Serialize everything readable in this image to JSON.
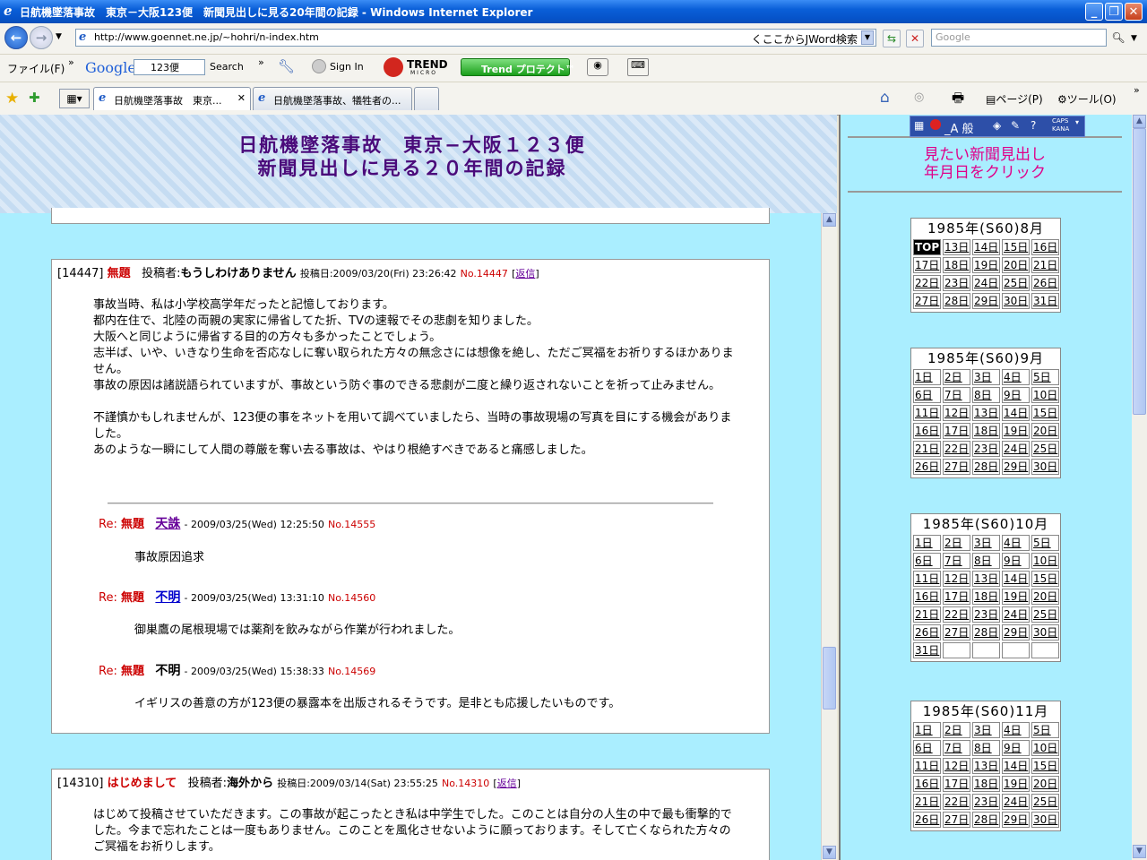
{
  "window": {
    "title": "日航機墜落事故　東京－大阪123便　新聞見出しに見る20年間の記録 - Windows Internet Explorer"
  },
  "address": {
    "url": "http://www.goennet.ne.jp/~hohri/n-index.htm",
    "jword": "くここからJWord検索",
    "search_placeholder": "Google"
  },
  "toolbar": {
    "file_menu": "ファイル(F)",
    "google_label": "Google",
    "google_field": "123便",
    "search_label": "Search",
    "signin_label": "Sign In",
    "trend_label": "TREND",
    "trend_sub": "MICRO",
    "trend_protect": "Trend プロテクト™"
  },
  "tabs": [
    {
      "label": "日航機墜落事故　東京..."
    },
    {
      "label": "日航機墜落事故、犠牲者の..."
    }
  ],
  "commandbar": {
    "page_label": "ページ(P)",
    "tools_label": "ツール(O)"
  },
  "banner": {
    "line1": "日航機墜落事故　東京−大阪１２３便",
    "line2": "新聞見出しに見る２０年間の記録"
  },
  "posts": [
    {
      "id": "[14447]",
      "title": "無題",
      "author_label": "投稿者:",
      "author": "もうしわけありません",
      "date": "投稿日:2009/03/20(Fri) 23:26:42",
      "no": "No.14447",
      "reply_link": "返信",
      "body": "事故当時、私は小学校高学年だったと記憶しております。\n都内在住で、北陸の両親の実家に帰省してた折、TVの速報でその悲劇を知りました。\n大阪へと同じように帰省する目的の方々も多かったことでしょう。\n志半ば、いや、いきなり生命を否応なしに奪い取られた方々の無念さには想像を絶し、ただご冥福をお祈りするほかありません。\n事故の原因は諸説語られていますが、事故という防ぐ事のできる悲劇が二度と繰り返されないことを祈って止みません。\n\n不謹慎かもしれませんが、123便の事をネットを用いて調べていましたら、当時の事故現場の写真を目にする機会がありました。\nあのような一瞬にして人間の尊厳を奪い去る事故は、やはり根絶すべきであると痛感しました。",
      "replies": [
        {
          "prefix": "Re: ",
          "title": "無題",
          "author": "天誅",
          "date": "- 2009/03/25(Wed) 12:25:50",
          "no": "No.14555",
          "body": "事故原因追求"
        },
        {
          "prefix": "Re: ",
          "title": "無題",
          "author": "不明",
          "date": "- 2009/03/25(Wed) 13:31:10",
          "no": "No.14560",
          "body": "御巣鷹の尾根現場では薬剤を飲みながら作業が行われました。"
        },
        {
          "prefix": "Re: ",
          "title": "無題",
          "author": "不明",
          "date": "- 2009/03/25(Wed) 15:38:33",
          "no": "No.14569",
          "body": "イギリスの善意の方が123便の暴露本を出版されるそうです。是非とも応援したいものです。"
        }
      ]
    },
    {
      "id": "[14310]",
      "title": "はじめまして",
      "author_label": "投稿者:",
      "author": "海外から",
      "date": "投稿日:2009/03/14(Sat) 23:55:25",
      "no": "No.14310",
      "reply_link": "返信",
      "body": "はじめて投稿させていただきます。この事故が起こったとき私は中学生でした。このことは自分の人生の中で最も衝撃的でした。今まで忘れたことは一度もありません。このことを風化させないように願っております。そして亡くなられた方々のご冥福をお祈りします。"
    }
  ],
  "right": {
    "ime": "_A 般",
    "caps": "CAPS",
    "kana": "KANA",
    "heading1": "見たい新聞見出し",
    "heading2": "年月日をクリック",
    "calendars": [
      {
        "title": "1985年(S60)8月",
        "days": [
          "TOP",
          "13日",
          "14日",
          "15日",
          "16日",
          "17日",
          "18日",
          "19日",
          "20日",
          "21日",
          "22日",
          "23日",
          "24日",
          "25日",
          "26日",
          "27日",
          "28日",
          "29日",
          "30日",
          "31日"
        ]
      },
      {
        "title": "1985年(S60)9月",
        "days": [
          "1日",
          "2日",
          "3日",
          "4日",
          "5日",
          "6日",
          "7日",
          "8日",
          "9日",
          "10日",
          "11日",
          "12日",
          "13日",
          "14日",
          "15日",
          "16日",
          "17日",
          "18日",
          "19日",
          "20日",
          "21日",
          "22日",
          "23日",
          "24日",
          "25日",
          "26日",
          "27日",
          "28日",
          "29日",
          "30日"
        ]
      },
      {
        "title": "1985年(S60)10月",
        "days": [
          "1日",
          "2日",
          "3日",
          "4日",
          "5日",
          "6日",
          "7日",
          "8日",
          "9日",
          "10日",
          "11日",
          "12日",
          "13日",
          "14日",
          "15日",
          "16日",
          "17日",
          "18日",
          "19日",
          "20日",
          "21日",
          "22日",
          "23日",
          "24日",
          "25日",
          "26日",
          "27日",
          "28日",
          "29日",
          "30日",
          "31日",
          "",
          "",
          "",
          ""
        ]
      },
      {
        "title": "1985年(S60)11月",
        "days": [
          "1日",
          "2日",
          "3日",
          "4日",
          "5日",
          "6日",
          "7日",
          "8日",
          "9日",
          "10日",
          "11日",
          "12日",
          "13日",
          "14日",
          "15日",
          "16日",
          "17日",
          "18日",
          "19日",
          "20日",
          "21日",
          "22日",
          "23日",
          "24日",
          "25日",
          "26日",
          "27日",
          "28日",
          "29日",
          "30日"
        ]
      }
    ]
  }
}
